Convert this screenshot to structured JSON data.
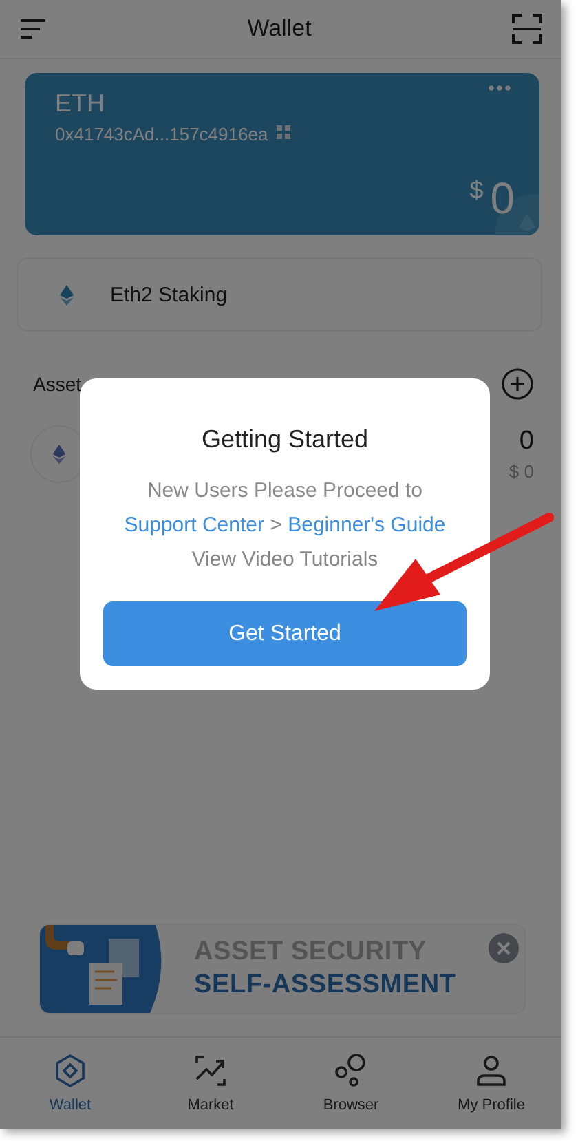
{
  "header": {
    "title": "Wallet"
  },
  "account_card": {
    "name": "ETH",
    "address": "0x41743cAd...157c4916ea",
    "currency": "$",
    "balance": "0"
  },
  "staking": {
    "label": "Eth2 Staking"
  },
  "assets": {
    "heading": "Asset",
    "rows": [
      {
        "amount": "0",
        "value": "$ 0"
      }
    ]
  },
  "dialog": {
    "title": "Getting Started",
    "line_1": "New Users Please Proceed to",
    "link_1": "Support Center",
    "separator": ">",
    "link_2": "Beginner's Guide",
    "line_3": "View Video Tutorials",
    "button": "Get Started"
  },
  "banner": {
    "title": "ASSET SECURITY",
    "subtitle": "SELF-ASSESSMENT"
  },
  "tabs": [
    {
      "label": "Wallet",
      "selected": true,
      "kind": "wallet"
    },
    {
      "label": "Market",
      "selected": false,
      "kind": "market"
    },
    {
      "label": "Browser",
      "selected": false,
      "kind": "browser"
    },
    {
      "label": "My Profile",
      "selected": false,
      "kind": "profile"
    }
  ]
}
